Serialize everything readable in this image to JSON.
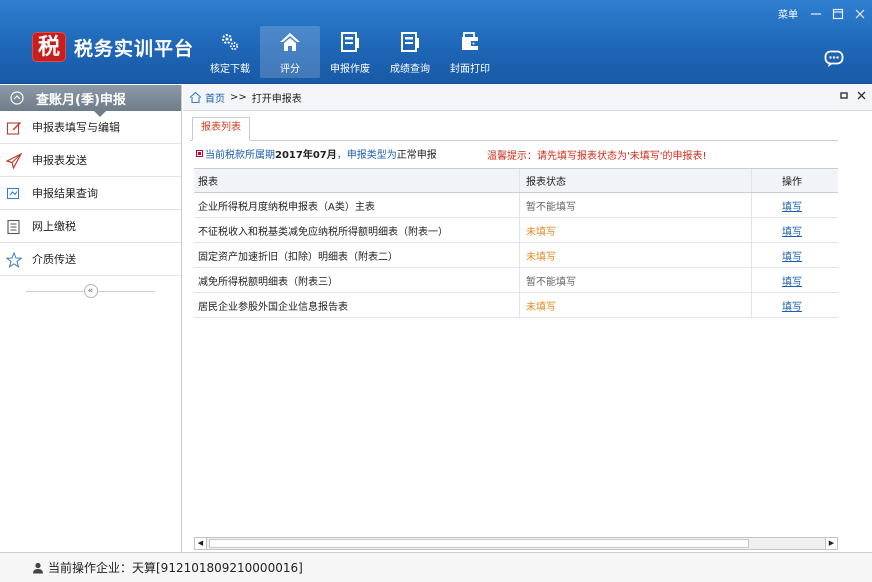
{
  "app": {
    "logo_char": "税",
    "title": "税务实训平台",
    "menu_label": "菜单",
    "accent": "#1f67b8"
  },
  "nav": [
    {
      "label": "核定下载",
      "icon": "gears-icon",
      "active": false
    },
    {
      "label": "评分",
      "icon": "home-icon",
      "active": true
    },
    {
      "label": "申报作废",
      "icon": "document-icon",
      "active": false
    },
    {
      "label": "成绩查询",
      "icon": "document-icon",
      "active": false
    },
    {
      "label": "封面打印",
      "icon": "wallet-icon",
      "active": false
    }
  ],
  "sidebar": {
    "title": "查账月(季)申报",
    "items": [
      {
        "label": "申报表填写与编辑",
        "icon": "edit-icon"
      },
      {
        "label": "申报表发送",
        "icon": "send-icon"
      },
      {
        "label": "申报结果查询",
        "icon": "search-icon"
      },
      {
        "label": "网上缴税",
        "icon": "list-icon"
      },
      {
        "label": "介质传送",
        "icon": "star-icon"
      }
    ],
    "collapse_symbol": "«"
  },
  "breadcrumb": {
    "home": "首页",
    "separator": ">>",
    "current": "打开申报表"
  },
  "tabs": [
    {
      "label": "报表列表"
    }
  ],
  "info": {
    "prefix": "当前税款所属期",
    "period": "2017年07月",
    "mid": "，申报类型为",
    "type": "正常申报",
    "warning": "温馨提示：请先填写报表状态为'未填写'的申报表!"
  },
  "table": {
    "headers": {
      "name": "报表",
      "status": "报表状态",
      "op": "操作"
    },
    "rows": [
      {
        "name": "企业所得税月度纳税申报表（A类）主表",
        "status": "暂不能填写",
        "status_kind": "disabled",
        "op": "填写"
      },
      {
        "name": "不征税收入和税基类减免应纳税所得额明细表（附表一）",
        "status": "未填写",
        "status_kind": "empty",
        "op": "填写"
      },
      {
        "name": "固定资产加速折旧（扣除）明细表（附表二）",
        "status": "未填写",
        "status_kind": "empty",
        "op": "填写"
      },
      {
        "name": "减免所得税额明细表（附表三）",
        "status": "暂不能填写",
        "status_kind": "disabled",
        "op": "填写"
      },
      {
        "name": "居民企业参股外国企业信息报告表",
        "status": "未填写",
        "status_kind": "empty",
        "op": "填写"
      }
    ]
  },
  "statusbar": {
    "text": "当前操作企业：天算[912101809210000016]"
  }
}
